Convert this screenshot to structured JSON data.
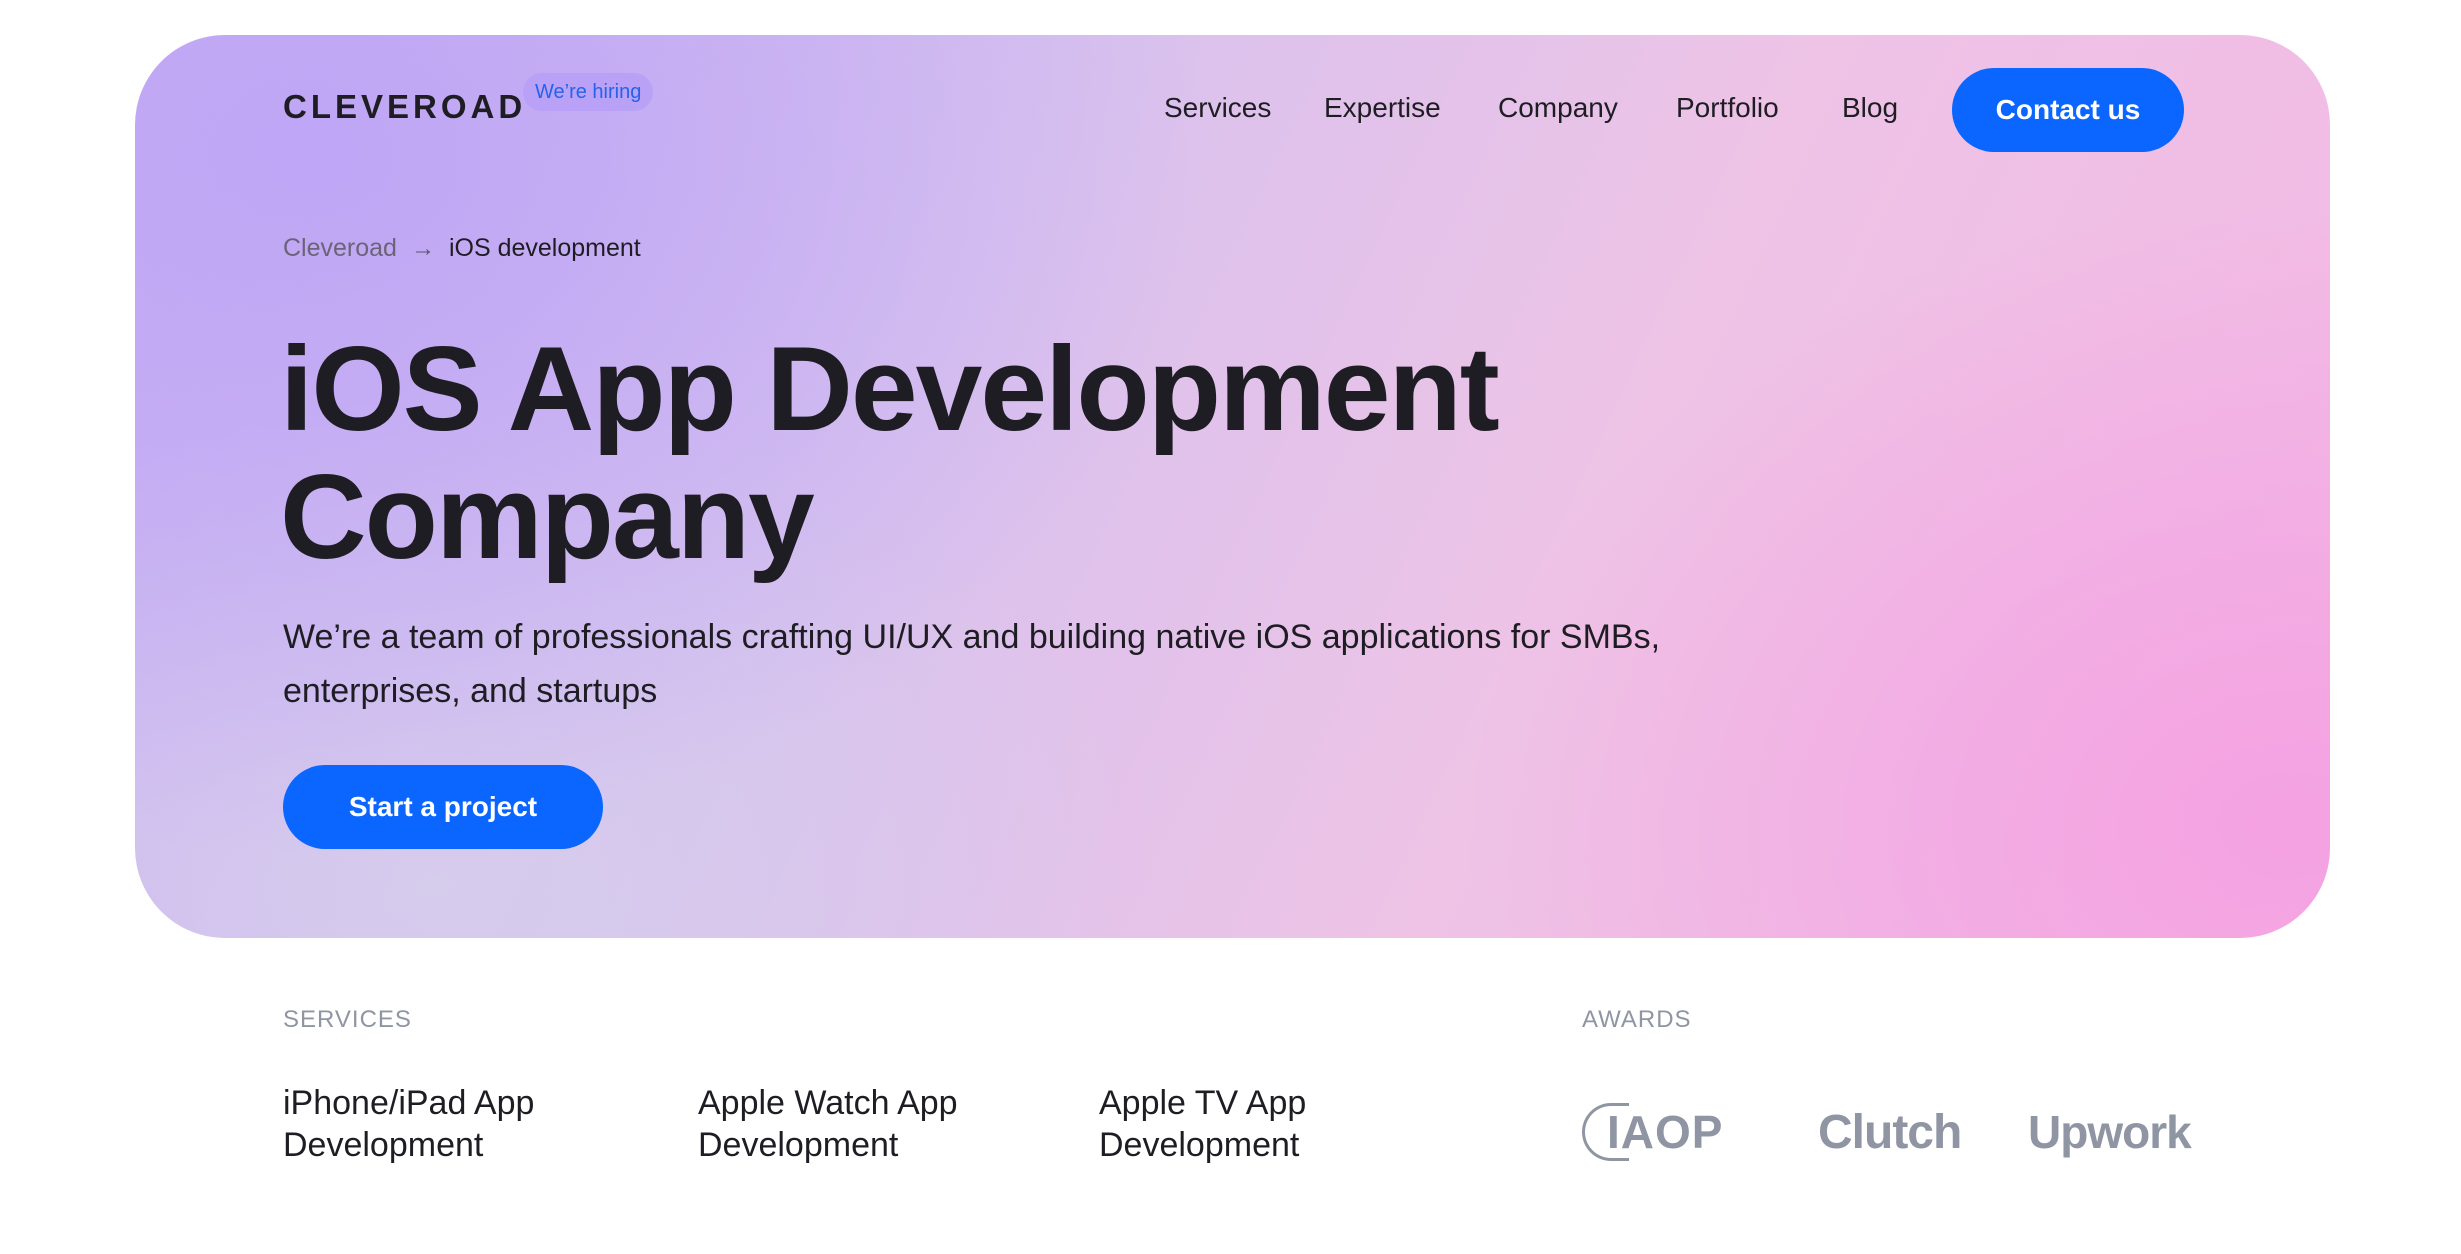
{
  "header": {
    "logo": "CLEVEROAD",
    "hiring_badge": "We’re hiring",
    "nav": [
      "Services",
      "Expertise",
      "Company",
      "Portfolio",
      "Blog"
    ],
    "contact_label": "Contact us"
  },
  "breadcrumb": {
    "home": "Cleveroad",
    "arrow": "→",
    "current": "iOS development"
  },
  "hero": {
    "title_line1": "iOS App Development",
    "title_line2": "Company",
    "description": "We’re a team of professionals crafting UI/UX and building native iOS applications for SMBs, enterprises, and startups",
    "cta_label": "Start a project"
  },
  "services": {
    "label": "SERVICES",
    "items": [
      {
        "line1": "iPhone/iPad App",
        "line2": "Development"
      },
      {
        "line1": "Apple Watch App",
        "line2": "Development"
      },
      {
        "line1": "Apple TV App",
        "line2": "Development"
      }
    ]
  },
  "awards": {
    "label": "AWARDS",
    "logos": [
      "IAOP",
      "Clutch",
      "Upwork"
    ]
  },
  "colors": {
    "accent": "#0a66ff",
    "text": "#1f1d24",
    "muted": "#8f95a3",
    "badge_text": "#2563eb"
  },
  "icons": {
    "breadcrumb_separator": "arrow-right-icon"
  }
}
